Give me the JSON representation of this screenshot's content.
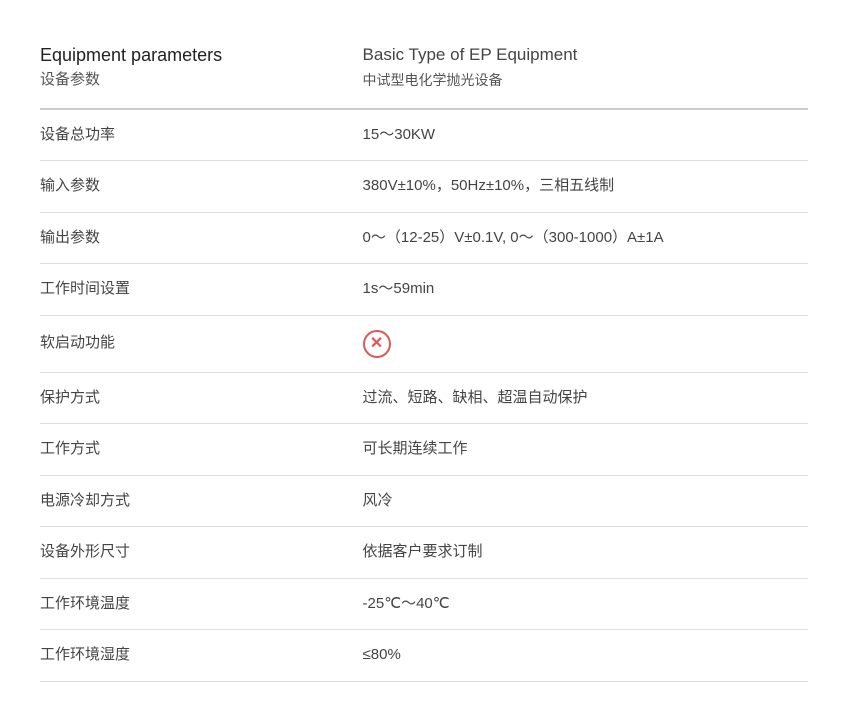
{
  "header": {
    "col1_en": "Equipment parameters",
    "col1_zh": "设备参数",
    "col2_en": "Basic Type of EP Equipment",
    "col2_zh": "中试型电化学抛光设备"
  },
  "rows": [
    {
      "param": "设备总功率",
      "value": "15～30KW",
      "is_icon": false
    },
    {
      "param": "输入参数",
      "value": "380V±10%，50Hz±10%，三相五线制",
      "is_icon": false
    },
    {
      "param": "输出参数",
      "value": "0～（12-25）V±0.1V, 0～（300-1000）A±1A",
      "is_icon": false
    },
    {
      "param": "工作时间设置",
      "value": "1s～59min",
      "is_icon": false
    },
    {
      "param": "软启动功能",
      "value": "",
      "is_icon": true
    },
    {
      "param": "保护方式",
      "value": "过流、短路、缺相、超温自动保护",
      "is_icon": false
    },
    {
      "param": "工作方式",
      "value": "可长期连续工作",
      "is_icon": false
    },
    {
      "param": "电源冷却方式",
      "value": "风冷",
      "is_icon": false
    },
    {
      "param": "设备外形尺寸",
      "value": "依据客户要求订制",
      "is_icon": false
    },
    {
      "param": "工作环境温度",
      "value": "-25℃～40℃",
      "is_icon": false
    },
    {
      "param": "工作环境湿度",
      "value": "≤80%",
      "is_icon": false
    }
  ],
  "icon": {
    "symbol": "✕"
  }
}
